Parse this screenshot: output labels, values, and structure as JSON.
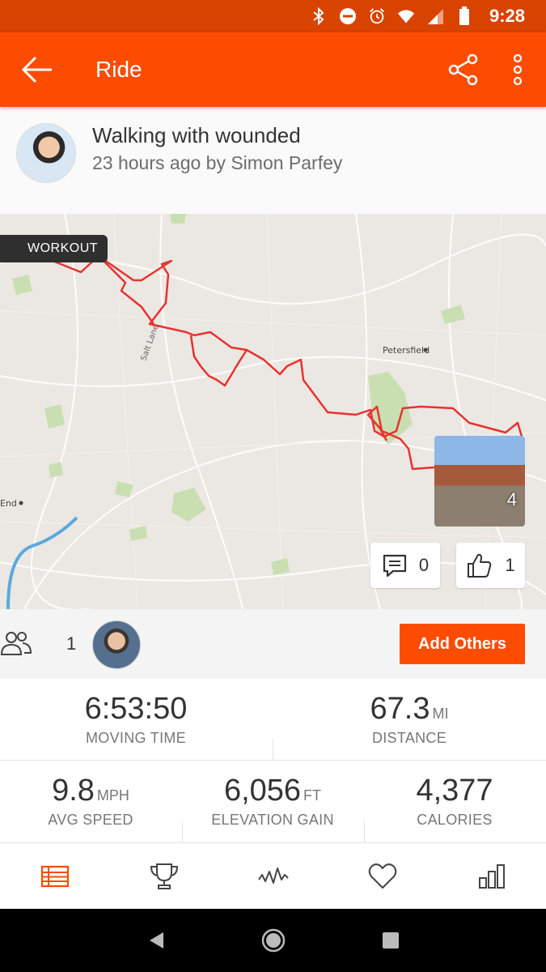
{
  "status_bar": {
    "time": "9:28",
    "icons": [
      "bluetooth-icon",
      "do-not-disturb-icon",
      "alarm-icon",
      "wifi-icon",
      "signal-icon",
      "battery-icon"
    ]
  },
  "app_bar": {
    "title": "Ride",
    "icons": [
      "back-arrow-icon",
      "share-icon",
      "more-vert-icon"
    ]
  },
  "activity": {
    "title": "Walking with wounded",
    "subtitle": "23 hours ago by Simon Parfey"
  },
  "map": {
    "badge": "WORKOUT",
    "labels": {
      "town": "Petersfield",
      "road": "Salt Lane",
      "place": "End"
    },
    "photo_count": "4",
    "comments": "0",
    "kudos": "1"
  },
  "athletes": {
    "count": "1",
    "add_label": "Add Others"
  },
  "stats": {
    "moving_time": {
      "value": "6:53:50",
      "unit": "",
      "label": "MOVING TIME"
    },
    "distance": {
      "value": "67.3",
      "unit": "MI",
      "label": "DISTANCE"
    },
    "avg_speed": {
      "value": "9.8",
      "unit": "MPH",
      "label": "AVG SPEED"
    },
    "elevation": {
      "value": "6,056",
      "unit": "FT",
      "label": "ELEVATION GAIN"
    },
    "calories": {
      "value": "4,377",
      "unit": "",
      "label": "CALORIES"
    }
  },
  "tabs": [
    "overview-icon",
    "trophy-icon",
    "analysis-icon",
    "heart-icon",
    "bar-chart-icon"
  ],
  "colors": {
    "accent": "#fc4c02",
    "status_bar": "#d84300",
    "route": "#e8322f"
  }
}
